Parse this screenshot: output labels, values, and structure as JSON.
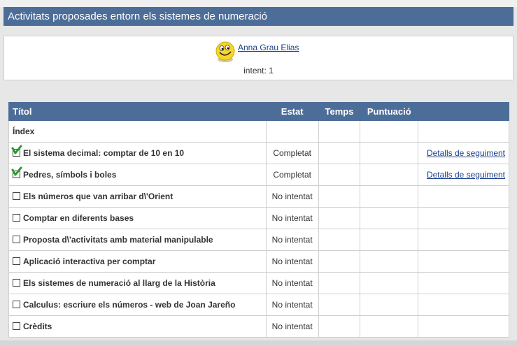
{
  "page": {
    "title": "Activitats proposades entorn els sistemes de numeració"
  },
  "user": {
    "name": "Anna Grau Elias",
    "attempt": "intent: 1"
  },
  "table": {
    "headers": [
      "Títol",
      "Estat",
      "Temps",
      "Puntuació"
    ],
    "rows": [
      {
        "title": "Índex",
        "status": "",
        "check": "none",
        "link": ""
      },
      {
        "title": "El sistema decimal: comptar de 10 en 10",
        "status": "Completat",
        "check": "done",
        "link": "Detalls de seguiment"
      },
      {
        "title": "Pedres, símbols i boles",
        "status": "Completat",
        "check": "done",
        "link": "Detalls de seguiment"
      },
      {
        "title": "Els números que van arribar d\\'Orient",
        "status": "No intentat",
        "check": "empty",
        "link": ""
      },
      {
        "title": "Comptar en diferents bases",
        "status": "No intentat",
        "check": "empty",
        "link": ""
      },
      {
        "title": "Proposta d\\'activitats amb material manipulable",
        "status": "No intentat",
        "check": "empty",
        "link": ""
      },
      {
        "title": "Aplicació interactiva per comptar",
        "status": "No intentat",
        "check": "empty",
        "link": ""
      },
      {
        "title": "Els sistemes de numeració al llarg de la Història",
        "status": "No intentat",
        "check": "empty",
        "link": ""
      },
      {
        "title": "Calculus: escriure els números - web de Joan Jareño",
        "status": "No intentat",
        "check": "empty",
        "link": ""
      },
      {
        "title": "Crèdits",
        "status": "No intentat",
        "check": "empty",
        "link": ""
      }
    ]
  },
  "colors": {
    "header_bg": "#4d6d99",
    "link": "#1a3f8a",
    "tick": "#2e9a2e"
  },
  "icons": {
    "avatar": "smiley-face-icon",
    "completed": "green-checkmark-icon",
    "not_attempted": "empty-checkbox-icon"
  }
}
